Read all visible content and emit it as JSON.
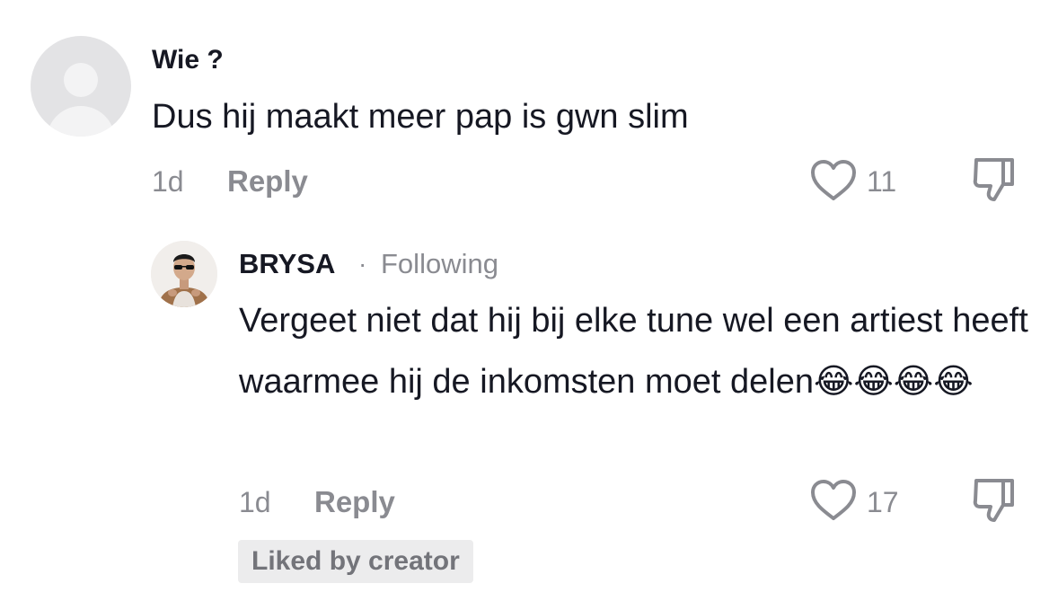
{
  "comments": [
    {
      "username": "Wie ?",
      "text": "Dus hij maakt meer pap is gwn slim",
      "time": "1d",
      "reply_label": "Reply",
      "like_count": "11",
      "avatar": "default-avatar"
    },
    {
      "username": "BRYSA",
      "separator": "·",
      "follow_status": "Following",
      "text": "Vergeet niet dat hij bij elke tune wel een artiest heeft waarmee hij de inkomsten moet delen😂😂😂😂",
      "time": "1d",
      "reply_label": "Reply",
      "like_count": "17",
      "liked_by_creator_label": "Liked by creator",
      "avatar": "user-photo-avatar"
    }
  ],
  "colors": {
    "primary_text": "#161823",
    "secondary_text": "#8a8b91",
    "badge_bg": "#ececed",
    "emoji_face": "#f5c33b"
  },
  "icons": {
    "like": "heart-outline-icon",
    "dislike": "thumbs-down-outline-icon"
  }
}
